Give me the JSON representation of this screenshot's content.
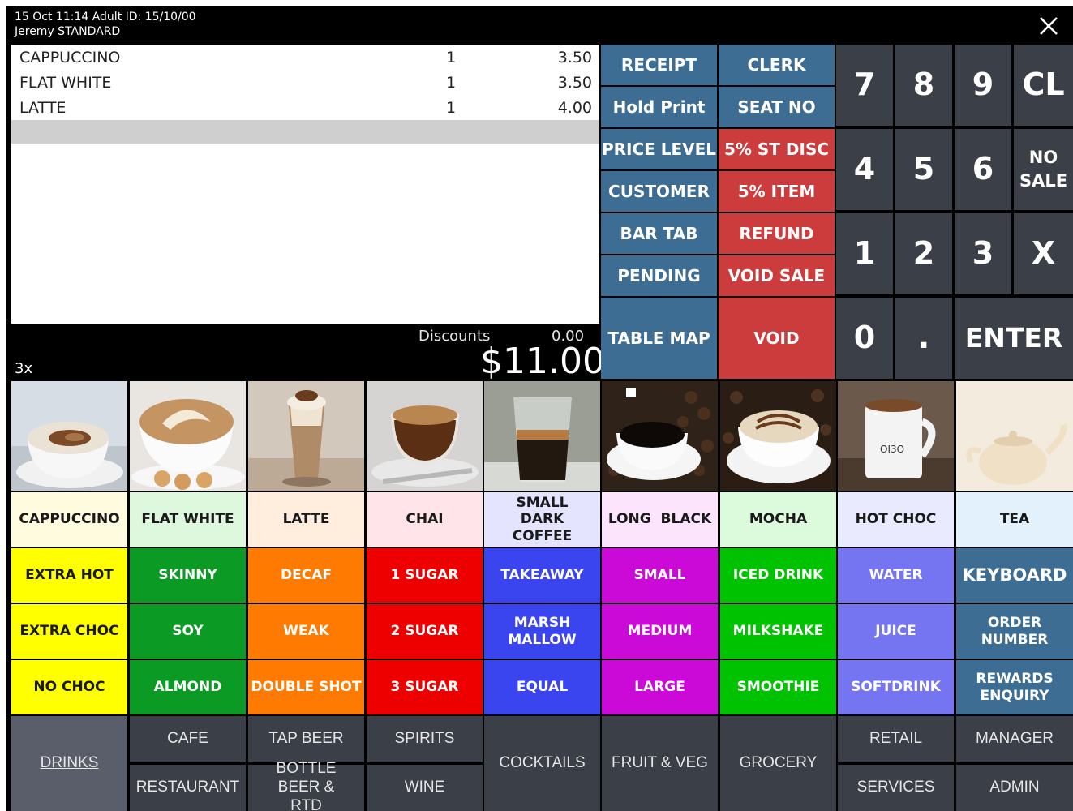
{
  "header": {
    "line1": "15 Oct 11:14  Adult ID: 15/10/00",
    "line2": "Jeremy  STANDARD",
    "close_icon": "close-icon"
  },
  "order": {
    "items": [
      {
        "name": "CAPPUCCINO",
        "qty": "1",
        "price": "3.50"
      },
      {
        "name": "FLAT WHITE",
        "qty": "1",
        "price": "3.50"
      },
      {
        "name": "LATTE",
        "qty": "1",
        "price": "4.00"
      }
    ],
    "multiplier": "3x",
    "discounts_label": "Discounts",
    "discounts_value": "0.00",
    "total": "$11.00"
  },
  "functions": {
    "receipt": "RECEIPT",
    "clerk": "CLERK",
    "hold_print": "Hold Print",
    "seat_no": "SEAT NO",
    "price_level": "PRICE LEVEL",
    "st_disc": "5% ST DISC",
    "customer": "CUSTOMER",
    "item_disc": "5% ITEM",
    "bar_tab": "BAR TAB",
    "refund": "REFUND",
    "pending": "PENDING",
    "void_sale": "VOID SALE",
    "table_map": "TABLE MAP",
    "void": "VOID"
  },
  "keypad": {
    "k7": "7",
    "k8": "8",
    "k9": "9",
    "cl": "CL",
    "k4": "4",
    "k5": "5",
    "k6": "6",
    "no": "NO",
    "sale": "SALE",
    "k1": "1",
    "k2": "2",
    "k3": "3",
    "x": "X",
    "k0": "0",
    "dot": ".",
    "enter": "ENTER"
  },
  "products": [
    {
      "label": "CAPPUCCINO",
      "bg": "#fffbdf",
      "image": "cappuccino-photo"
    },
    {
      "label": "FLAT WHITE",
      "bg": "#ddf8dd",
      "image": "flat-white-photo"
    },
    {
      "label": "LATTE",
      "bg": "#ffeede",
      "image": "latte-photo"
    },
    {
      "label": "CHAI",
      "bg": "#ffe4ea",
      "image": "chai-photo"
    },
    {
      "label": "SMALL DARK COFFEE",
      "bg": "#e4e4ff",
      "image": "small-dark-coffee-photo"
    },
    {
      "label": "LONG  BLACK",
      "bg": "#fde4fd",
      "image": "long-black-photo"
    },
    {
      "label": "MOCHA",
      "bg": "#dcfadc",
      "image": "mocha-photo"
    },
    {
      "label": "HOT CHOC",
      "bg": "#eaeaff",
      "image": "hot-choc-photo"
    },
    {
      "label": "TEA",
      "bg": "#e2f1fb",
      "image": "tea-photo"
    }
  ],
  "modifiers": [
    [
      {
        "label": "EXTRA HOT",
        "bg": "#ffff00",
        "dark": true
      },
      {
        "label": "SKINNY",
        "bg": "#0b9a23"
      },
      {
        "label": "DECAF",
        "bg": "#ff7a00"
      },
      {
        "label": "1 SUGAR",
        "bg": "#ee0000"
      },
      {
        "label": "TAKEAWAY",
        "bg": "#3a45f0"
      },
      {
        "label": "SMALL",
        "bg": "#cc0ad8"
      },
      {
        "label": "ICED DRINK",
        "bg": "#00c200"
      },
      {
        "label": "WATER",
        "bg": "#7575f2"
      },
      {
        "label": "KEYBOARD",
        "bg": "#3d6d93"
      }
    ],
    [
      {
        "label": "EXTRA CHOC",
        "bg": "#ffff00",
        "dark": true
      },
      {
        "label": "SOY",
        "bg": "#0b9a23"
      },
      {
        "label": "WEAK",
        "bg": "#ff7a00"
      },
      {
        "label": "2 SUGAR",
        "bg": "#ee0000"
      },
      {
        "label": "MARSH MALLOW",
        "bg": "#3a45f0"
      },
      {
        "label": "MEDIUM",
        "bg": "#cc0ad8"
      },
      {
        "label": "MILKSHAKE",
        "bg": "#00c200"
      },
      {
        "label": "JUICE",
        "bg": "#7575f2"
      },
      {
        "label": "ORDER NUMBER",
        "bg": "#3d6d93"
      }
    ],
    [
      {
        "label": "NO CHOC",
        "bg": "#ffff00",
        "dark": true
      },
      {
        "label": "ALMOND",
        "bg": "#0b9a23"
      },
      {
        "label": "DOUBLE SHOT",
        "bg": "#ff7a00"
      },
      {
        "label": "3 SUGAR",
        "bg": "#ee0000"
      },
      {
        "label": "EQUAL",
        "bg": "#3a45f0"
      },
      {
        "label": "LARGE",
        "bg": "#cc0ad8"
      },
      {
        "label": "SMOOTHIE",
        "bg": "#00c200"
      },
      {
        "label": "SOFTDRINK",
        "bg": "#7575f2"
      },
      {
        "label": "REWARDS ENQUIRY",
        "bg": "#3d6d93"
      }
    ]
  ],
  "categories": {
    "drinks": "DRINKS",
    "cafe": "CAFE",
    "restaurant": "RESTAURANT",
    "tap_beer": "TAP BEER",
    "bottle_beer": "BOTTLE BEER & RTD",
    "spirits": "SPIRITS",
    "wine": "WINE",
    "cocktails": "COCKTAILS",
    "fruit_veg": "FRUIT & VEG",
    "grocery": "GROCERY",
    "retail": "RETAIL",
    "services": "SERVICES",
    "manager": "MANAGER",
    "admin": "ADMIN"
  }
}
